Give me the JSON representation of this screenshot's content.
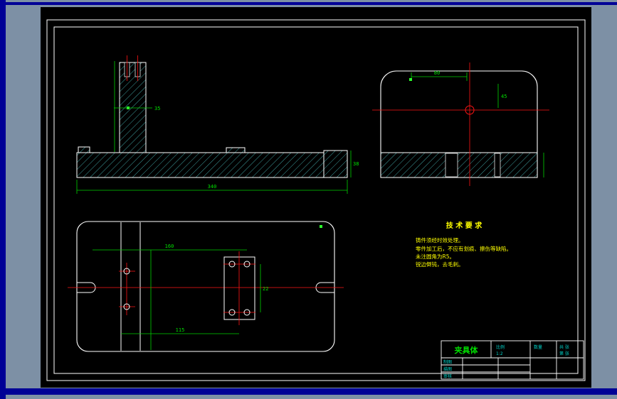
{
  "colors": {
    "desktop_bg": "#7d90a5",
    "window_border": "#000096",
    "canvas_bg": "#000000",
    "frame": "#ffffff",
    "hatch": "#3f9f9f",
    "dimension": "#00d200",
    "centerline": "#ff1414",
    "notes": "#ffff00",
    "title_block_text": "#00d2c8",
    "part_name_text": "#00e000"
  },
  "tech_requirements": {
    "title": "技 术 要 求",
    "lines": [
      "铸件须经时效处理。",
      "零件加工后，不应有划痕、擦伤等缺陷。",
      "未注圆角为R5。",
      "锐边倒钝，去毛刺。"
    ]
  },
  "dimensions": {
    "front_overall": "340",
    "front_height": "38",
    "front_col_w": "35",
    "side_width": "80",
    "side_offset": "45",
    "plan_width": "160",
    "plan_len": "115",
    "hole_pitch": "22"
  },
  "title_block": {
    "part_name": "夹具体",
    "scale_label": "比例",
    "scale_value": "1:2",
    "qty_label": "数量",
    "sheet_total": "共 张",
    "sheet_no": "第 张",
    "row_labels": [
      "制图",
      "描图",
      "审核"
    ]
  }
}
